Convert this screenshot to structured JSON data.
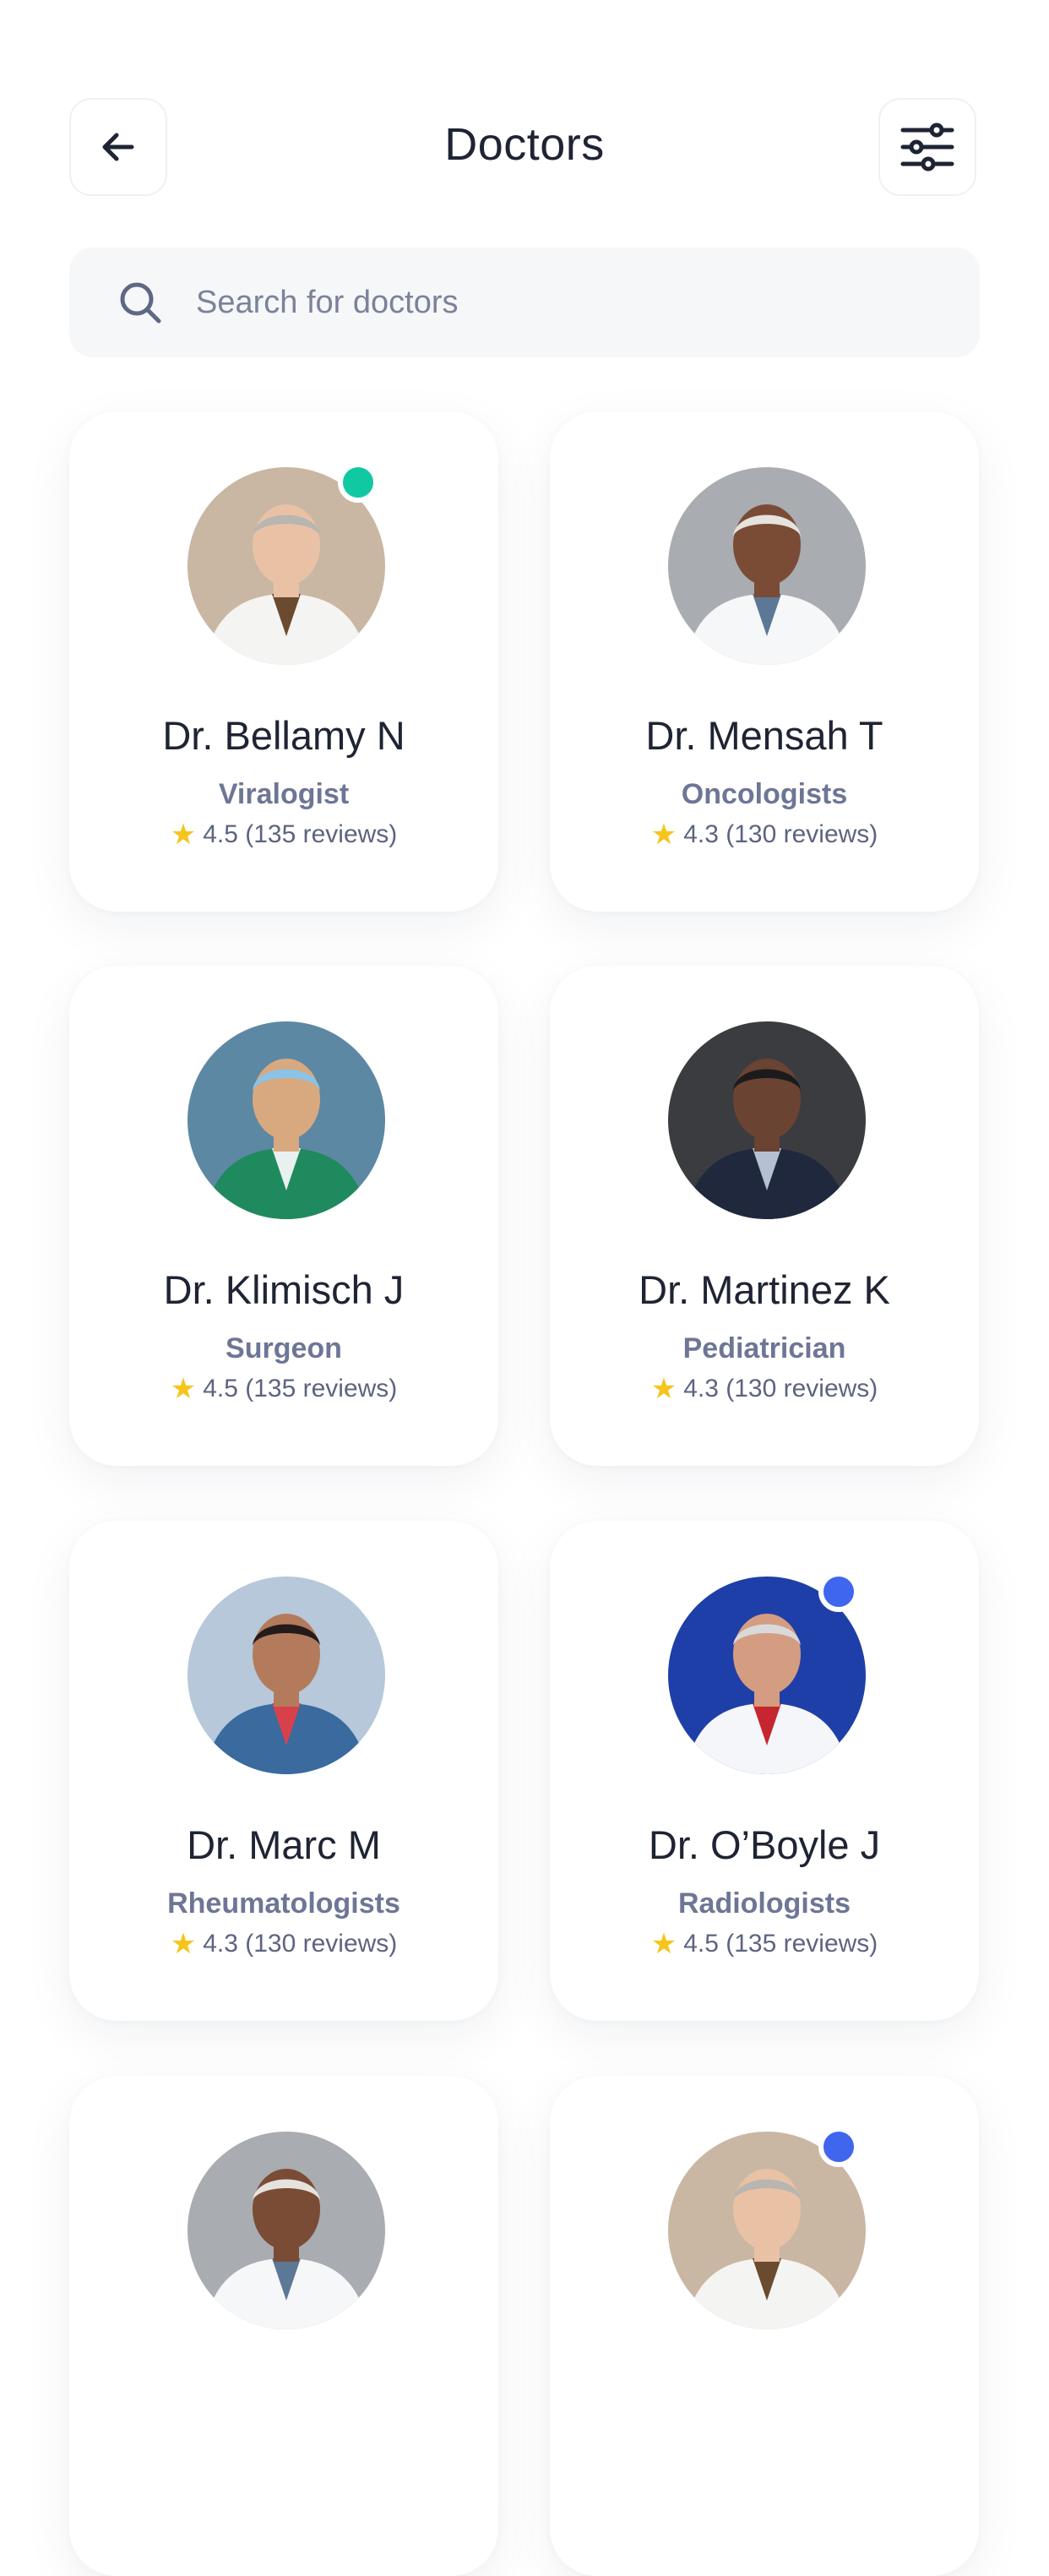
{
  "header": {
    "title": "Doctors",
    "back_icon": "arrow-left-icon",
    "filter_icon": "sliders-icon"
  },
  "search": {
    "placeholder": "Search for doctors",
    "icon": "search-icon"
  },
  "colors": {
    "online": "#10c9a3",
    "busy": "#3f66ee",
    "star": "#f5c51b"
  },
  "doctors": [
    {
      "name": "Dr. Bellamy N",
      "specialty": "Viralogist",
      "rating": "4.5 (135 reviews)",
      "status": "online"
    },
    {
      "name": "Dr. Mensah T",
      "specialty": "Oncologists",
      "rating": "4.3 (130 reviews)",
      "status": "none"
    },
    {
      "name": "Dr. Klimisch J",
      "specialty": "Surgeon",
      "rating": "4.5 (135 reviews)",
      "status": "none"
    },
    {
      "name": "Dr. Martinez K",
      "specialty": "Pediatrician",
      "rating": "4.3 (130 reviews)",
      "status": "none"
    },
    {
      "name": "Dr. Marc M",
      "specialty": "Rheumatologists",
      "rating": "4.3 (130 reviews)",
      "status": "none"
    },
    {
      "name": "Dr. O’Boyle J",
      "specialty": "Radiologists",
      "rating": "4.5 (135 reviews)",
      "status": "busy"
    },
    {
      "name": "",
      "specialty": "",
      "rating": "",
      "status": "none"
    },
    {
      "name": "",
      "specialty": "",
      "rating": "",
      "status": "busy"
    }
  ]
}
